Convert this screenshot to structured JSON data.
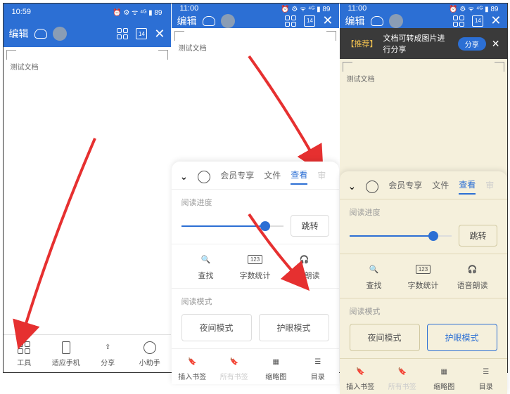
{
  "screens": {
    "left": {
      "time": "10:59",
      "doc_title": "测试文档",
      "header_edit": "编辑",
      "date_badge": "14",
      "bottom_nav": {
        "tools": "工具",
        "adapt": "适应手机",
        "share": "分享",
        "assistant": "小助手"
      }
    },
    "middle": {
      "time": "11:00",
      "doc_title": "测试文档",
      "header_edit": "编辑",
      "date_badge": "14",
      "tabs": {
        "member": "会员专享",
        "file": "文件",
        "view": "查看",
        "more": "审"
      },
      "progress_label": "阅读进度",
      "jump": "跳转",
      "actions": {
        "find": "查找",
        "count": "字数统计",
        "tts": "语音朗读"
      },
      "mode_label": "阅读模式",
      "modes": {
        "night": "夜间模式",
        "eye": "护眼模式"
      },
      "tools": {
        "bookmark": "插入书签",
        "allbm": "所有书签",
        "thumb": "缩略图",
        "toc": "目录"
      },
      "slider_pct": 82
    },
    "right": {
      "time": "11:00",
      "doc_title": "测试文档",
      "header_edit": "编辑",
      "date_badge": "14",
      "banner": {
        "tag": "【推荐】",
        "text": "文档可转成图片进行分享",
        "share": "分享"
      },
      "tabs": {
        "member": "会员专享",
        "file": "文件",
        "view": "查看",
        "more": "审"
      },
      "progress_label": "阅读进度",
      "jump": "跳转",
      "actions": {
        "find": "查找",
        "count": "字数统计",
        "tts": "语音朗读"
      },
      "mode_label": "阅读模式",
      "modes": {
        "night": "夜间模式",
        "eye": "护眼模式"
      },
      "tools": {
        "bookmark": "插入书签",
        "allbm": "所有书签",
        "thumb": "缩略图",
        "toc": "目录"
      },
      "slider_pct": 82
    }
  }
}
